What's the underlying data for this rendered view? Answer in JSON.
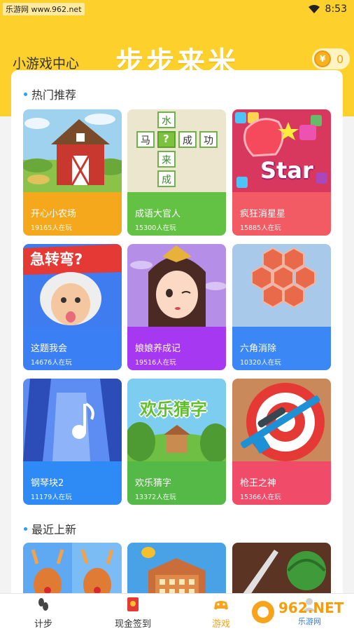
{
  "status_bar": {
    "watermark": "乐游网 www.962.net",
    "time": "8:53"
  },
  "header": {
    "center_title": "小游戏中心",
    "brand": "步步来米",
    "coin_value": "0",
    "coin_symbol": "¥"
  },
  "sections": {
    "hot": {
      "title": "热门推荐"
    },
    "new": {
      "title": "最近上新"
    }
  },
  "games": [
    {
      "name": "开心小农场",
      "players": "19165人在玩",
      "color": "#f6a81d",
      "icon": "farm-barn-icon"
    },
    {
      "name": "成语大官人",
      "players": "15300人在玩",
      "color": "#63c244",
      "icon": "idiom-puzzle-icon"
    },
    {
      "name": "疯狂消星星",
      "players": "15885人在玩",
      "color": "#f25b63",
      "icon": "star-blocks-icon"
    },
    {
      "name": "这题我会",
      "players": "14676人在玩",
      "color": "#3b7ff5",
      "icon": "einstein-quiz-icon"
    },
    {
      "name": "娘娘养成记",
      "players": "19516人在玩",
      "color": "#a538f0",
      "icon": "empress-icon"
    },
    {
      "name": "六角消除",
      "players": "10320人在玩",
      "color": "#3b87f6",
      "icon": "hexagon-icon"
    },
    {
      "name": "钢琴块2",
      "players": "11179人在玩",
      "color": "#2e8af5",
      "icon": "piano-tiles-icon"
    },
    {
      "name": "欢乐猜字",
      "players": "13372人在玩",
      "color": "#55b947",
      "icon": "word-guess-icon"
    },
    {
      "name": "枪王之神",
      "players": "15366人在玩",
      "color": "#f14b6a",
      "icon": "rifle-target-icon"
    }
  ],
  "idiom_chars": {
    "top": "水",
    "left": "马",
    "mid": "?",
    "right1": "成",
    "right2": "功",
    "bottom1": "来",
    "bottom2": "成"
  },
  "art_text": {
    "star": "Star",
    "quiz": "急转弯?",
    "word": "欢乐猜字"
  },
  "nav": [
    {
      "label": "计步",
      "icon": "steps-icon"
    },
    {
      "label": "现金签到",
      "icon": "red-envelope-icon"
    },
    {
      "label": "游戏",
      "icon": "gamepad-icon"
    },
    {
      "label": "",
      "icon": "profile-icon"
    }
  ],
  "watermark_logo": {
    "brand": "962.NET",
    "sub": "乐游网"
  }
}
